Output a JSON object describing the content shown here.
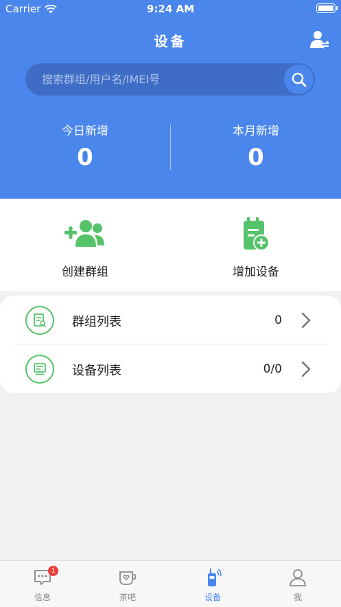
{
  "status_bar": {
    "carrier": "Carrier",
    "time": "9:24 AM"
  },
  "header": {
    "title": "设备",
    "search_placeholder": "搜索群组/用户名/IMEI号"
  },
  "stats": [
    {
      "label": "今日新增",
      "value": "0"
    },
    {
      "label": "本月新增",
      "value": "0"
    }
  ],
  "actions": [
    {
      "label": "创建群组",
      "icon": "add-group-icon"
    },
    {
      "label": "增加设备",
      "icon": "add-device-icon"
    }
  ],
  "list": [
    {
      "label": "群组列表",
      "value": "0",
      "icon": "group-list-icon"
    },
    {
      "label": "设备列表",
      "value": "0/0",
      "icon": "device-list-icon"
    }
  ],
  "tabbar": {
    "active_index": 2,
    "items": [
      {
        "label": "信息",
        "badge": "1",
        "icon": "message-icon"
      },
      {
        "label": "茶吧",
        "icon": "tea-cup-icon"
      },
      {
        "label": "设备",
        "icon": "walkie-talkie-icon"
      },
      {
        "label": "我",
        "icon": "person-icon"
      }
    ]
  },
  "colors": {
    "primary": "#4a86ec",
    "search_bg": "#3f6dc6",
    "green": "#56c26a",
    "badge": "#ea3b3b"
  }
}
